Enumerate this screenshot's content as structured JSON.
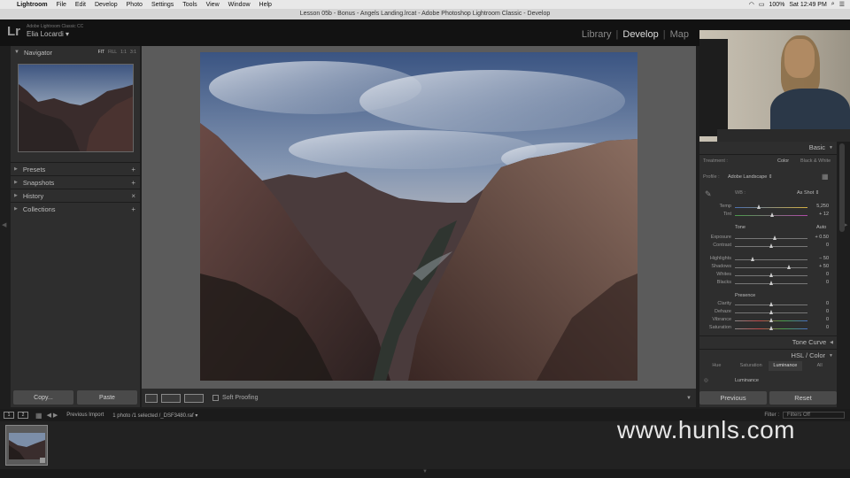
{
  "menubar": {
    "app": "Lightroom",
    "menus": [
      "File",
      "Edit",
      "Develop",
      "Photo",
      "Settings",
      "Tools",
      "View",
      "Window",
      "Help"
    ],
    "battery": "100%",
    "clock": "Sat 12:49 PM"
  },
  "window_title": "Lesson 05b - Bonus - Angels Landing.lrcat - Adobe Photoshop Lightroom Classic - Develop",
  "identity": {
    "app_name": "Adobe Lightroom Classic CC",
    "user": "Elia Locardi ▾"
  },
  "modules": {
    "library": "Library",
    "develop": "Develop",
    "map": "Map"
  },
  "left": {
    "navigator": {
      "title": "Navigator",
      "zoom_options": [
        "FIT",
        "FILL",
        "1:1",
        "3:1"
      ]
    },
    "panels": [
      {
        "label": "Presets",
        "action": "+"
      },
      {
        "label": "Snapshots",
        "action": "+"
      },
      {
        "label": "History",
        "action": "×"
      },
      {
        "label": "Collections",
        "action": "+"
      }
    ],
    "copy_button": "Copy...",
    "paste_button": "Paste"
  },
  "toolbar": {
    "soft_proofing": "Soft Proofing"
  },
  "right": {
    "basic_title": "Basic",
    "treatment_label": "Treatment :",
    "treatment_color": "Color",
    "treatment_bw": "Black & White",
    "profile_label": "Profile :",
    "profile_value": "Adobe Landscape ⇕",
    "wb_label": "WB :",
    "wb_value": "As Shot ⇕",
    "tone_label": "Tone",
    "tone_auto": "Auto",
    "presence_label": "Presence",
    "sliders": [
      {
        "label": "Temp",
        "value": "5,250",
        "pos": 0.34
      },
      {
        "label": "Tint",
        "value": "+ 12",
        "pos": 0.52
      },
      {
        "label": "Exposure",
        "value": "+ 0.50",
        "pos": 0.56
      },
      {
        "label": "Contrast",
        "value": "0",
        "pos": 0.5
      },
      {
        "label": "Highlights",
        "value": "− 50",
        "pos": 0.25
      },
      {
        "label": "Shadows",
        "value": "+ 50",
        "pos": 0.75
      },
      {
        "label": "Whites",
        "value": "0",
        "pos": 0.5
      },
      {
        "label": "Blacks",
        "value": "0",
        "pos": 0.5
      },
      {
        "label": "Clarity",
        "value": "0",
        "pos": 0.5
      },
      {
        "label": "Dehaze",
        "value": "0",
        "pos": 0.5
      },
      {
        "label": "Vibrance",
        "value": "0",
        "pos": 0.5
      },
      {
        "label": "Saturation",
        "value": "0",
        "pos": 0.5
      }
    ],
    "tone_curve_title": "Tone Curve",
    "hsl_title": "HSL / Color",
    "hsl_tabs": [
      "Hue",
      "Saturation",
      "Luminance",
      "All"
    ],
    "hsl_active": "Luminance",
    "luminance_label": "Luminance",
    "previous_button": "Previous",
    "reset_button": "Reset"
  },
  "filmbar": {
    "box1": "1",
    "box2": "2",
    "source": "Previous Import",
    "count": "1 photo /1 selected /_DSF3480.raf ▾",
    "filter_label": "Filter :",
    "filter_value": "Filters Off"
  },
  "watermark": "www.hunls.com"
}
